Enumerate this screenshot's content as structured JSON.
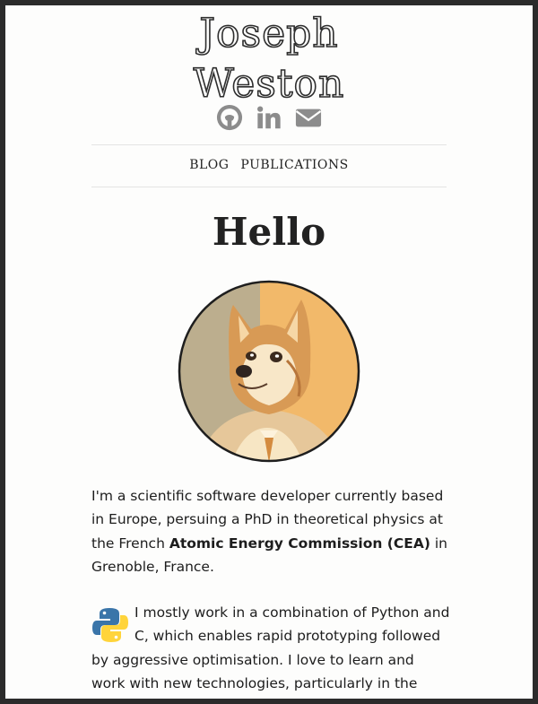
{
  "site": {
    "title_line1": "Joseph",
    "title_line2": "Weston"
  },
  "social": [
    {
      "icon": "github-icon",
      "label": "GitHub"
    },
    {
      "icon": "linkedin-icon",
      "label": "LinkedIn"
    },
    {
      "icon": "envelope-icon",
      "label": "Email"
    }
  ],
  "nav": {
    "items": [
      {
        "label": "BLOG"
      },
      {
        "label": "PUBLICATIONS"
      }
    ]
  },
  "main": {
    "heading": "Hello",
    "avatar_alt": "doge-avatar",
    "intro": {
      "t1": "I'm a scientific software developer currently based in Europe, persuing a PhD in theoretical physics at the French ",
      "bold": "Atomic Energy Commission (CEA)",
      "t2": " in Grenoble, France."
    },
    "work": {
      "text": "I mostly work in a combination of Python and C, which enables rapid prototyping followed by aggressive optimisation. I love to learn and work with new technologies, particularly in the field of high-performance computing."
    }
  },
  "colors": {
    "page_bg": "#fdfdfc",
    "frame": "#2b2b2b",
    "text": "#1d1d1d",
    "icon_gray": "#8c8c8c",
    "python_blue": "#3a75a9",
    "python_yellow": "#ffd43b"
  }
}
